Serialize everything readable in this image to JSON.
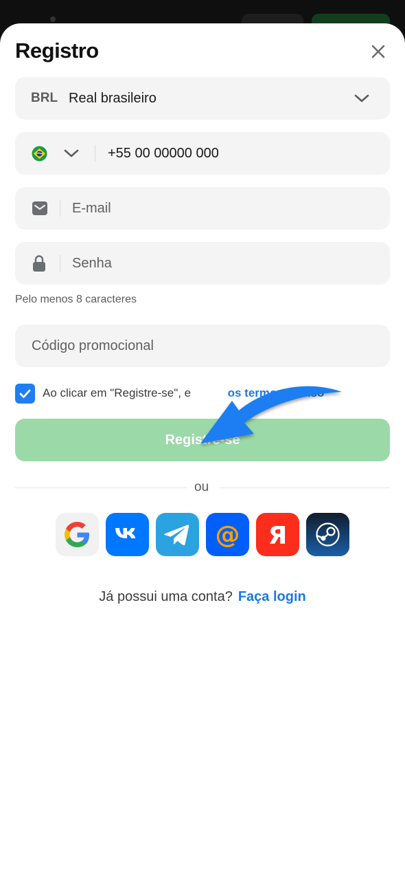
{
  "header": {
    "title": "Registro",
    "close_icon": "close-icon"
  },
  "currency": {
    "code": "BRL",
    "name": "Real brasileiro"
  },
  "phone": {
    "country_flag": "brazil-flag-icon",
    "value": "+55 00 00000 000"
  },
  "email": {
    "placeholder": "E-mail"
  },
  "password": {
    "placeholder": "Senha",
    "hint": "Pelo menos 8 caracteres"
  },
  "promo": {
    "placeholder": "Código promocional"
  },
  "terms": {
    "checked": true,
    "prefix": "Ao clicar em \"Registre-se\", e",
    "link": "os termos de uso"
  },
  "register_button": {
    "label": "Registre-se",
    "color": "#9bd9a8"
  },
  "divider": {
    "label": "ou"
  },
  "social": [
    {
      "name": "google-icon",
      "color": "#f1f1f1"
    },
    {
      "name": "vk-icon",
      "color": "#0077ff"
    },
    {
      "name": "telegram-icon",
      "color": "#2aa3e0"
    },
    {
      "name": "mail-ru-icon",
      "color": "#005ff9"
    },
    {
      "name": "yandex-icon",
      "color": "#fc2d1a"
    },
    {
      "name": "steam-icon",
      "color": "#0e2a4f"
    }
  ],
  "login": {
    "question": "Já possui uma conta?",
    "link": "Faça login"
  },
  "colors": {
    "accent": "#1a78e6",
    "field_bg": "#f4f4f4"
  }
}
